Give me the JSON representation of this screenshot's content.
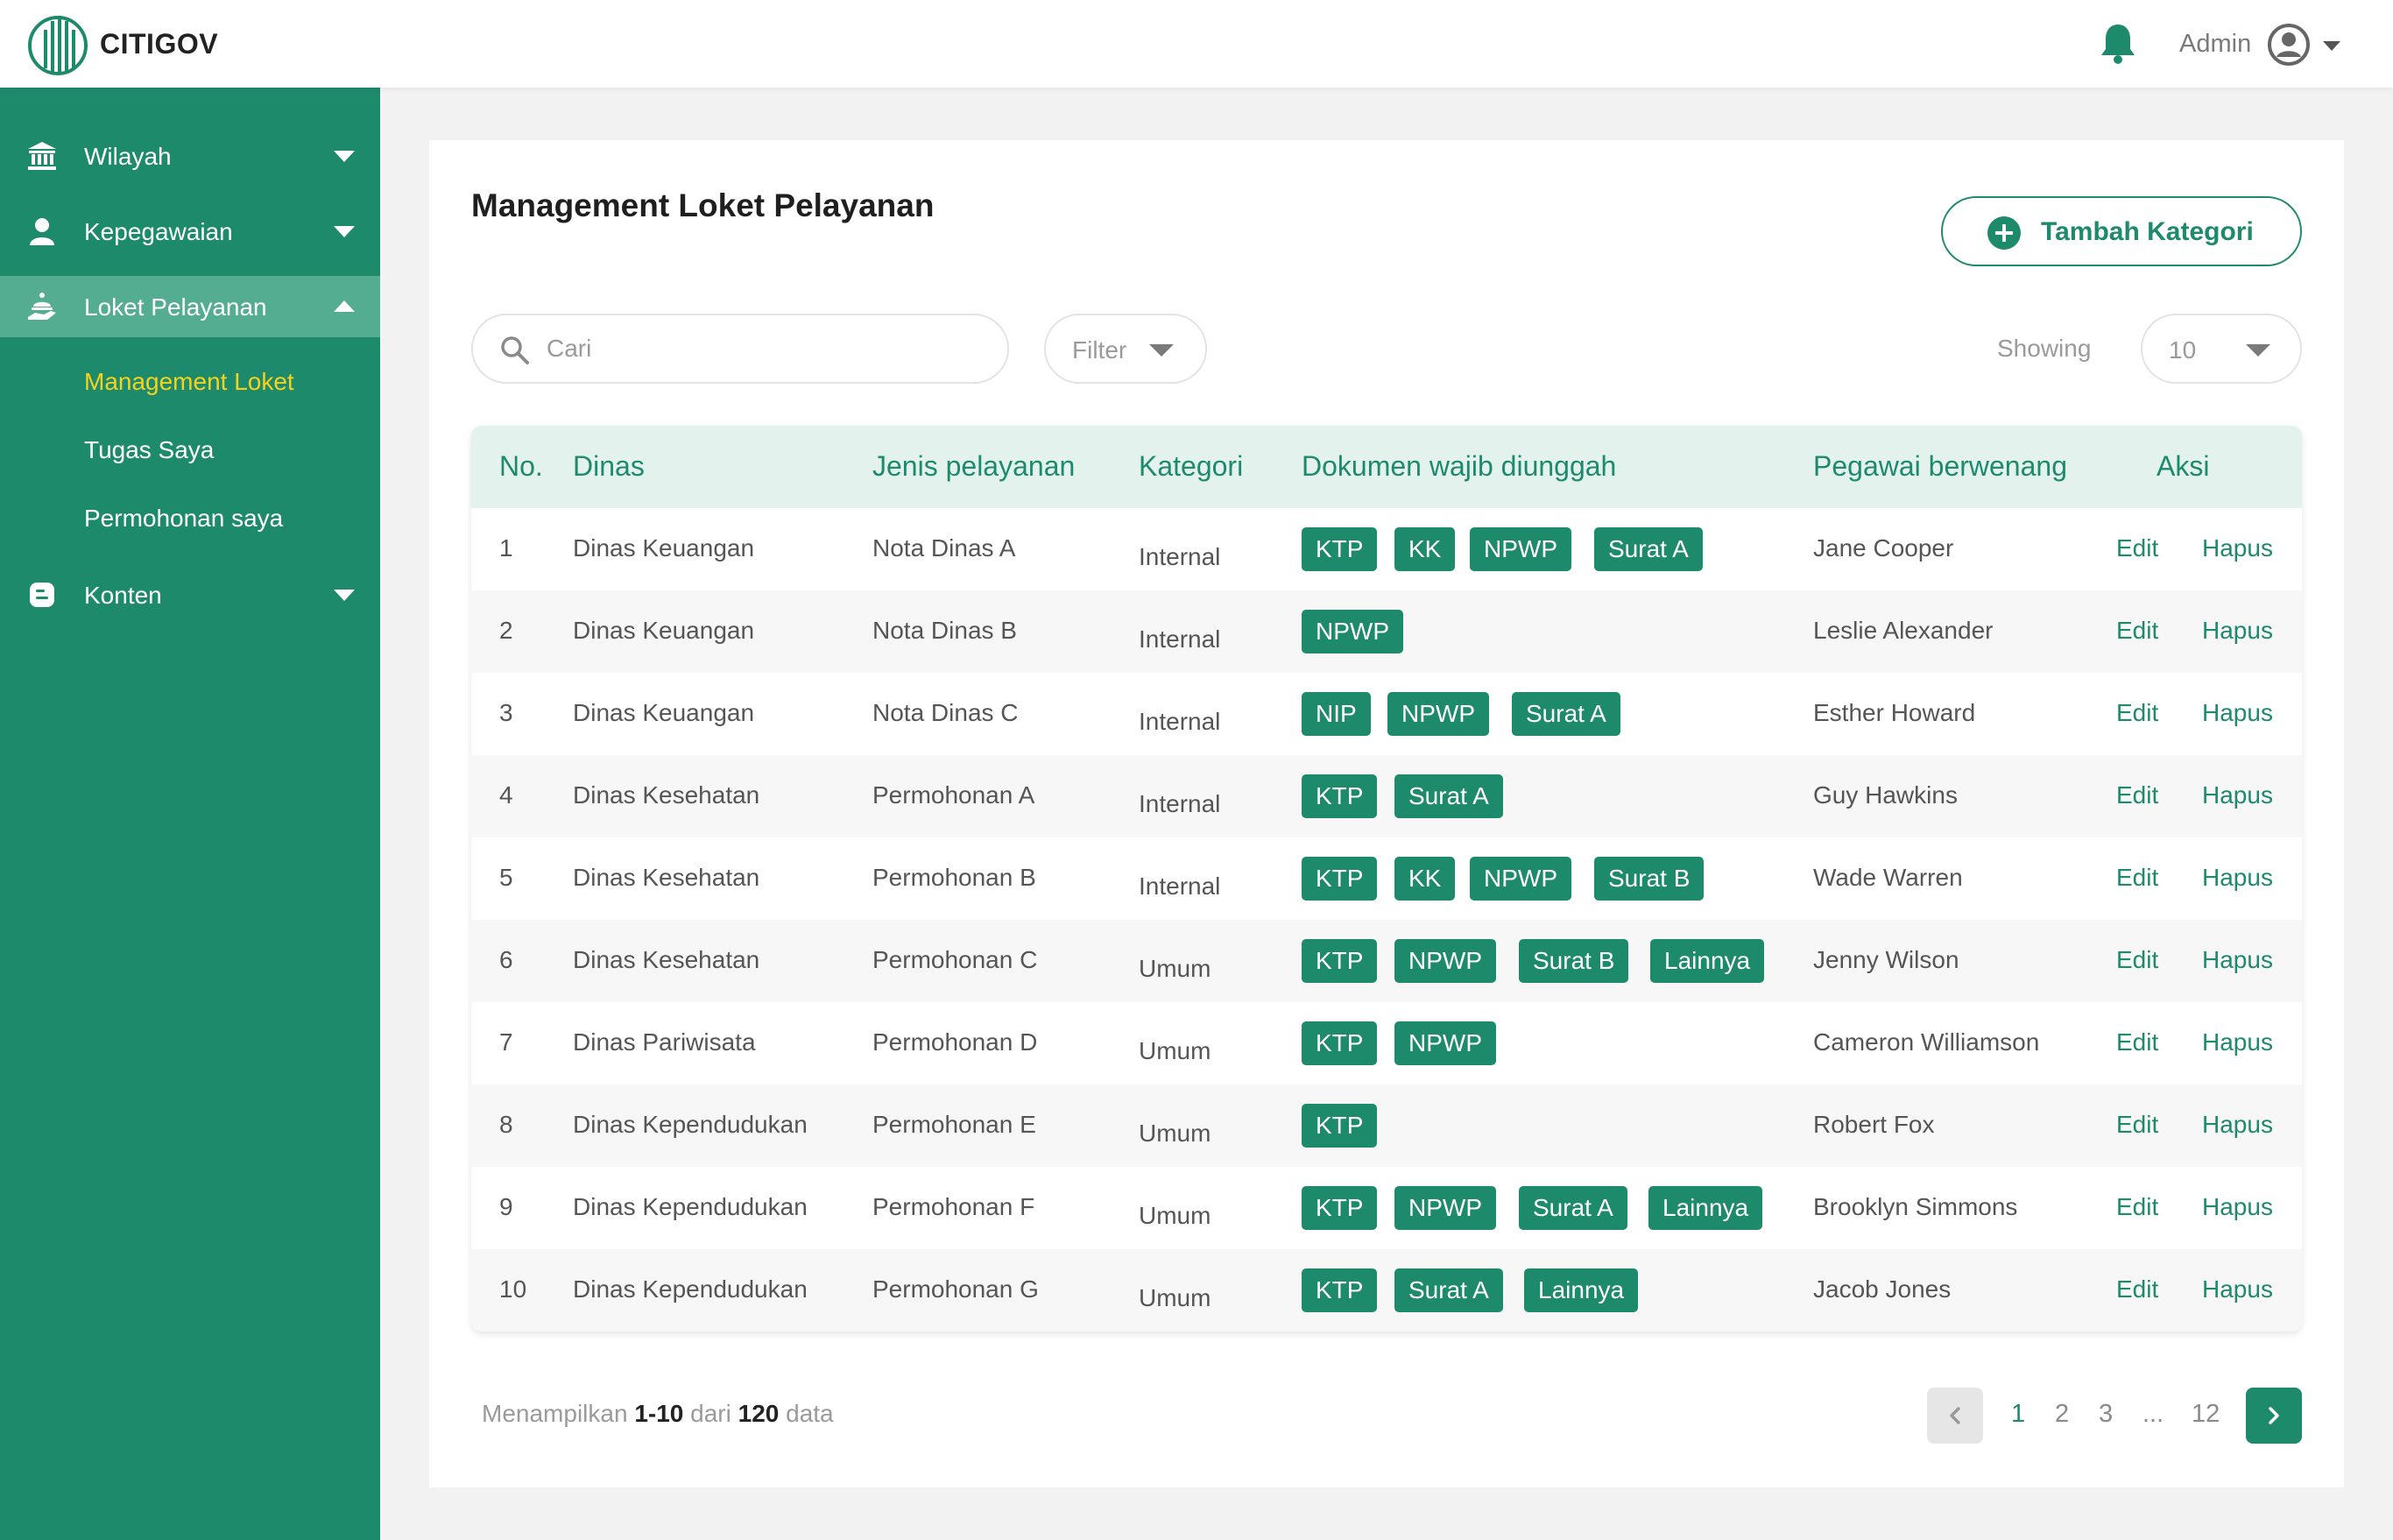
{
  "app": {
    "name": "CITIGOV"
  },
  "header": {
    "user_label": "Admin"
  },
  "sidebar": {
    "items": [
      {
        "label": "Wilayah",
        "icon": "bank-icon",
        "expanded": false
      },
      {
        "label": "Kepegawaian",
        "icon": "user-icon",
        "expanded": false
      },
      {
        "label": "Loket Pelayanan",
        "icon": "service-hand-icon",
        "expanded": true,
        "children": [
          {
            "label": "Management Loket",
            "current": true
          },
          {
            "label": "Tugas Saya",
            "current": false
          },
          {
            "label": "Permohonan saya",
            "current": false
          }
        ]
      },
      {
        "label": "Konten",
        "icon": "blog-icon",
        "expanded": false
      }
    ]
  },
  "main": {
    "title": "Management Loket Pelayanan",
    "add_button_label": "Tambah Kategori",
    "search": {
      "placeholder": "Cari",
      "value": ""
    },
    "filter_label": "Filter",
    "showing_label": "Showing",
    "page_size": "10",
    "table": {
      "headers": [
        "No.",
        "Dinas",
        "Jenis pelayanan",
        "Kategori",
        "Dokumen wajib diunggah",
        "Pegawai berwenang",
        "Aksi"
      ],
      "actions": {
        "edit": "Edit",
        "delete": "Hapus"
      },
      "rows": [
        {
          "no": "1",
          "dinas": "Dinas Keuangan",
          "jenis": "Nota Dinas A",
          "kategori": "Internal",
          "dokumen": [
            "KTP",
            "KK",
            "NPWP",
            "Surat A"
          ],
          "pegawai": "Jane Cooper"
        },
        {
          "no": "2",
          "dinas": "Dinas Keuangan",
          "jenis": "Nota Dinas B",
          "kategori": "Internal",
          "dokumen": [
            "NPWP"
          ],
          "pegawai": "Leslie Alexander"
        },
        {
          "no": "3",
          "dinas": "Dinas Keuangan",
          "jenis": "Nota Dinas C",
          "kategori": "Internal",
          "dokumen": [
            "NIP",
            "NPWP",
            "Surat A"
          ],
          "pegawai": "Esther Howard"
        },
        {
          "no": "4",
          "dinas": "Dinas Kesehatan",
          "jenis": "Permohonan A",
          "kategori": "Internal",
          "dokumen": [
            "KTP",
            "Surat A"
          ],
          "pegawai": "Guy Hawkins"
        },
        {
          "no": "5",
          "dinas": "Dinas Kesehatan",
          "jenis": "Permohonan B",
          "kategori": "Internal",
          "dokumen": [
            "KTP",
            "KK",
            "NPWP",
            "Surat B"
          ],
          "pegawai": "Wade Warren"
        },
        {
          "no": "6",
          "dinas": "Dinas Kesehatan",
          "jenis": "Permohonan C",
          "kategori": "Umum",
          "dokumen": [
            "KTP",
            "NPWP",
            "Surat B",
            "Lainnya"
          ],
          "pegawai": "Jenny Wilson"
        },
        {
          "no": "7",
          "dinas": "Dinas Pariwisata",
          "jenis": "Permohonan D",
          "kategori": "Umum",
          "dokumen": [
            "KTP",
            "NPWP"
          ],
          "pegawai": "Cameron Williamson"
        },
        {
          "no": "8",
          "dinas": "Dinas Kependudukan",
          "jenis": "Permohonan E",
          "kategori": "Umum",
          "dokumen": [
            "KTP"
          ],
          "pegawai": "Robert Fox"
        },
        {
          "no": "9",
          "dinas": "Dinas Kependudukan",
          "jenis": "Permohonan F",
          "kategori": "Umum",
          "dokumen": [
            "KTP",
            "NPWP",
            "Surat A",
            "Lainnya"
          ],
          "pegawai": "Brooklyn Simmons"
        },
        {
          "no": "10",
          "dinas": "Dinas Kependudukan",
          "jenis": "Permohonan G",
          "kategori": "Umum",
          "dokumen": [
            "KTP",
            "Surat A",
            "Lainnya"
          ],
          "pegawai": "Jacob Jones"
        }
      ]
    },
    "footer": {
      "summary_prefix": "Menampilkan",
      "range": "1-10",
      "summary_mid": "dari",
      "total": "120",
      "summary_suffix": "data",
      "pages": [
        "1",
        "2",
        "3",
        "...",
        "12"
      ],
      "current_page": "1"
    }
  },
  "colors": {
    "primary": "#1e8a6c",
    "active_nav": "#54ad91",
    "current_sub": "#f5d21c",
    "header_row": "#e4f2ee"
  }
}
